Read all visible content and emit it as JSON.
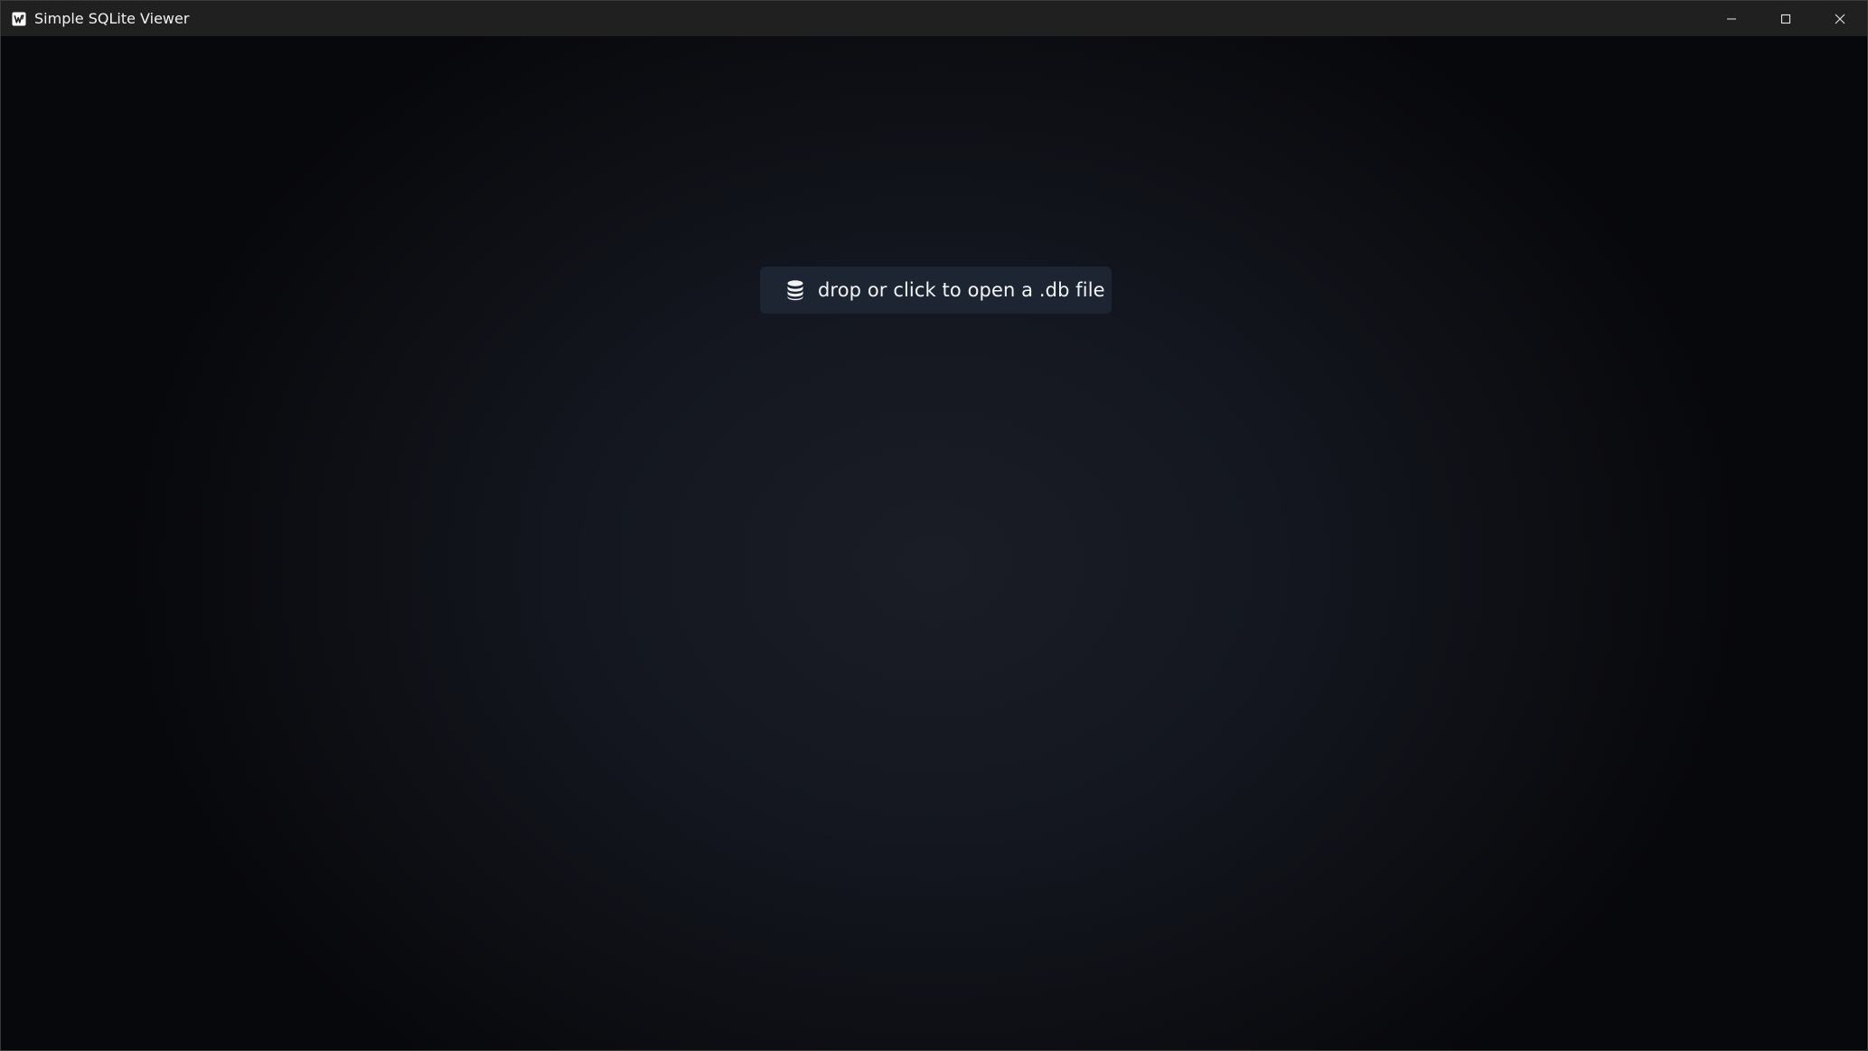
{
  "window": {
    "title": "Simple SQLite Viewer",
    "app_icon": "app-logo-icon",
    "controls": {
      "minimize_icon": "minimize-icon",
      "maximize_icon": "maximize-icon",
      "close_icon": "close-icon"
    }
  },
  "main": {
    "open_button": {
      "icon": "database-icon",
      "label": "drop or click to open a .db file"
    }
  },
  "colors": {
    "titlebar_bg": "#202020",
    "content_bg_center": "#1a1c26",
    "content_bg_edge": "#07080b",
    "button_bg": "#1d2533",
    "text": "#f3f4f6"
  }
}
